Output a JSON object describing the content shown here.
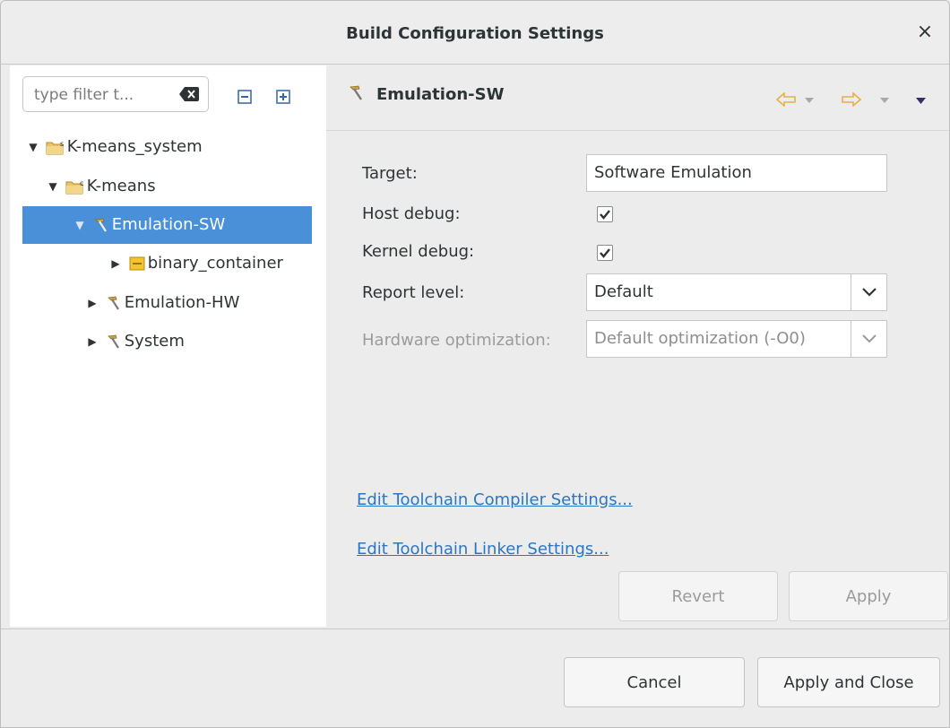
{
  "dialog": {
    "title": "Build Configuration Settings",
    "close_glyph": "×"
  },
  "left_panel": {
    "filter": {
      "placeholder": "type filter t..."
    },
    "tree": [
      {
        "label": "K-means_system",
        "icon": "project-system-icon",
        "expanded": true
      },
      {
        "label": "K-means",
        "icon": "project-c-icon",
        "expanded": true
      },
      {
        "label": "Emulation-SW",
        "icon": "hammer-icon",
        "expanded": true,
        "selected": true
      },
      {
        "label": "binary_container",
        "icon": "container-icon",
        "expanded": false
      },
      {
        "label": "Emulation-HW",
        "icon": "hammer-icon",
        "expanded": false
      },
      {
        "label": "System",
        "icon": "hammer-icon",
        "expanded": false
      }
    ]
  },
  "right_panel": {
    "header": {
      "title": "Emulation-SW",
      "icon": "hammer-icon"
    },
    "form": {
      "target_label": "Target:",
      "target_value": "Software Emulation",
      "host_debug_label": "Host debug:",
      "host_debug_checked": true,
      "kernel_debug_label": "Kernel debug:",
      "kernel_debug_checked": true,
      "report_level_label": "Report level:",
      "report_level_value": "Default",
      "hw_opt_label": "Hardware optimization:",
      "hw_opt_value": "Default optimization (-O0)"
    },
    "links": {
      "compiler": "Edit Toolchain Compiler Settings...",
      "linker": "Edit Toolchain Linker Settings..."
    },
    "buttons": {
      "revert": "Revert",
      "apply": "Apply"
    }
  },
  "footer": {
    "cancel": "Cancel",
    "apply_close": "Apply and Close"
  },
  "colors": {
    "selection": "#4a90d9",
    "link": "#2a76c6",
    "nav_arrow": "#e6b04a"
  }
}
